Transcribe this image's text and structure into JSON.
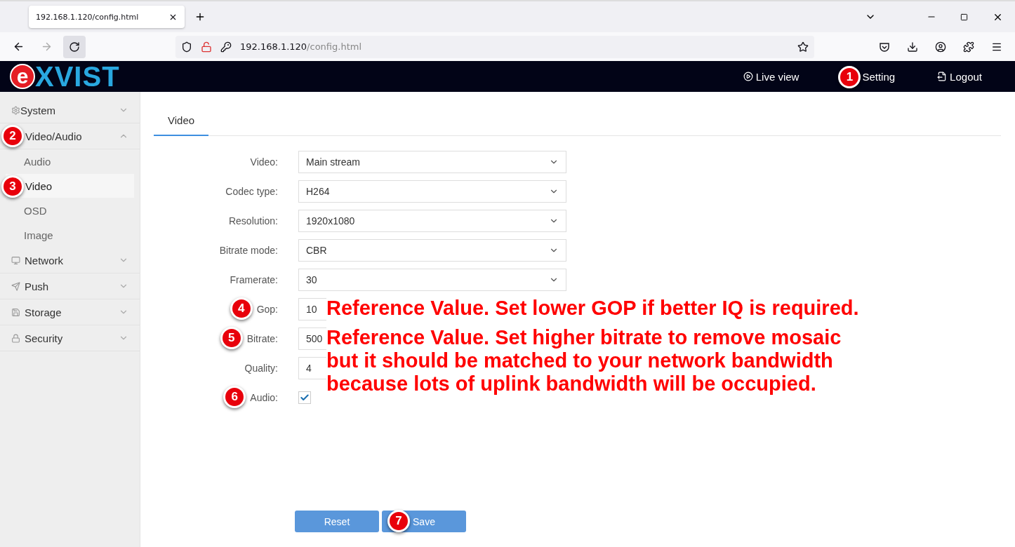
{
  "browser": {
    "tab_title": "192.168.1.120/config.html",
    "url_host": "192.168.1.120",
    "url_path": "/config.html"
  },
  "header": {
    "logo": {
      "mark": "e",
      "rest": "XVIST"
    },
    "nav": [
      {
        "label": "Live view",
        "kind": "play"
      },
      {
        "label": "Setting",
        "kind": "plain",
        "callout": "1"
      },
      {
        "label": "Logout",
        "kind": "logout"
      }
    ]
  },
  "sidebar": {
    "items": [
      {
        "label": "System",
        "kind": "gear",
        "expanded": false
      },
      {
        "label": "Video/Audio",
        "kind": "plain",
        "expanded": true,
        "callout": "2",
        "children": [
          {
            "label": "Audio",
            "selected": false
          },
          {
            "label": "Video",
            "selected": true,
            "callout": "3"
          },
          {
            "label": "OSD",
            "selected": false
          },
          {
            "label": "Image",
            "selected": false
          }
        ]
      },
      {
        "label": "Network",
        "kind": "monitor",
        "expanded": false
      },
      {
        "label": "Push",
        "kind": "send",
        "expanded": false
      },
      {
        "label": "Storage",
        "kind": "disk",
        "expanded": false
      },
      {
        "label": "Security",
        "kind": "lock",
        "expanded": false
      }
    ]
  },
  "tabs": [
    {
      "label": "Video",
      "selected": true
    }
  ],
  "form": {
    "fields": [
      {
        "label": "Video:",
        "kind": "select",
        "value": "Main stream"
      },
      {
        "label": "Codec type:",
        "kind": "select",
        "value": "H264"
      },
      {
        "label": "Resolution:",
        "kind": "select",
        "value": "1920x1080"
      },
      {
        "label": "Bitrate mode:",
        "kind": "select",
        "value": "CBR"
      },
      {
        "label": "Framerate:",
        "kind": "select",
        "value": "30"
      },
      {
        "label": "Gop:",
        "kind": "input",
        "value": "10",
        "callout": "4",
        "note": "Reference Value. Set lower GOP if better IQ is required."
      },
      {
        "label": "Bitrate:",
        "kind": "input",
        "value": "500",
        "callout": "5",
        "note": "Reference Value. Set higher bitrate to remove mosaic but it should be matched to your network bandwidth because lots of uplink bandwidth will be occupied."
      },
      {
        "label": "Quality:",
        "kind": "select",
        "value": "4"
      },
      {
        "label": "Audio:",
        "kind": "checkbox",
        "checked": true,
        "callout": "6"
      }
    ],
    "buttons": [
      {
        "label": "Reset"
      },
      {
        "label": "Save",
        "callout": "7"
      }
    ]
  }
}
